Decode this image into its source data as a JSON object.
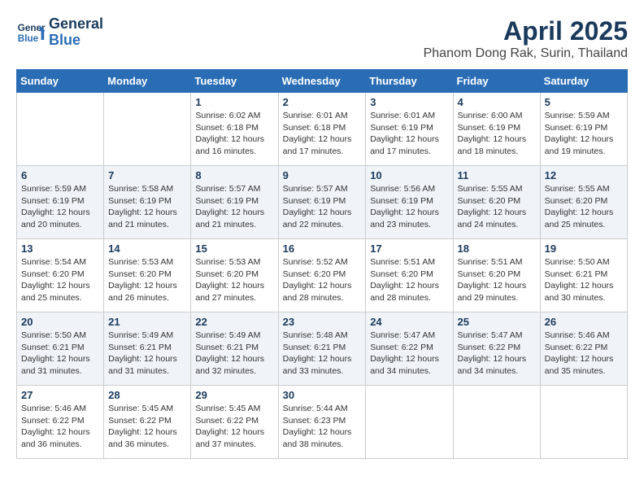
{
  "header": {
    "logo_line1": "General",
    "logo_line2": "Blue",
    "title": "April 2025",
    "subtitle": "Phanom Dong Rak, Surin, Thailand"
  },
  "weekdays": [
    "Sunday",
    "Monday",
    "Tuesday",
    "Wednesday",
    "Thursday",
    "Friday",
    "Saturday"
  ],
  "weeks": [
    [
      {
        "day": "",
        "info": ""
      },
      {
        "day": "",
        "info": ""
      },
      {
        "day": "1",
        "sunrise": "Sunrise: 6:02 AM",
        "sunset": "Sunset: 6:18 PM",
        "daylight": "Daylight: 12 hours and 16 minutes."
      },
      {
        "day": "2",
        "sunrise": "Sunrise: 6:01 AM",
        "sunset": "Sunset: 6:18 PM",
        "daylight": "Daylight: 12 hours and 17 minutes."
      },
      {
        "day": "3",
        "sunrise": "Sunrise: 6:01 AM",
        "sunset": "Sunset: 6:19 PM",
        "daylight": "Daylight: 12 hours and 17 minutes."
      },
      {
        "day": "4",
        "sunrise": "Sunrise: 6:00 AM",
        "sunset": "Sunset: 6:19 PM",
        "daylight": "Daylight: 12 hours and 18 minutes."
      },
      {
        "day": "5",
        "sunrise": "Sunrise: 5:59 AM",
        "sunset": "Sunset: 6:19 PM",
        "daylight": "Daylight: 12 hours and 19 minutes."
      }
    ],
    [
      {
        "day": "6",
        "sunrise": "Sunrise: 5:59 AM",
        "sunset": "Sunset: 6:19 PM",
        "daylight": "Daylight: 12 hours and 20 minutes."
      },
      {
        "day": "7",
        "sunrise": "Sunrise: 5:58 AM",
        "sunset": "Sunset: 6:19 PM",
        "daylight": "Daylight: 12 hours and 21 minutes."
      },
      {
        "day": "8",
        "sunrise": "Sunrise: 5:57 AM",
        "sunset": "Sunset: 6:19 PM",
        "daylight": "Daylight: 12 hours and 21 minutes."
      },
      {
        "day": "9",
        "sunrise": "Sunrise: 5:57 AM",
        "sunset": "Sunset: 6:19 PM",
        "daylight": "Daylight: 12 hours and 22 minutes."
      },
      {
        "day": "10",
        "sunrise": "Sunrise: 5:56 AM",
        "sunset": "Sunset: 6:19 PM",
        "daylight": "Daylight: 12 hours and 23 minutes."
      },
      {
        "day": "11",
        "sunrise": "Sunrise: 5:55 AM",
        "sunset": "Sunset: 6:20 PM",
        "daylight": "Daylight: 12 hours and 24 minutes."
      },
      {
        "day": "12",
        "sunrise": "Sunrise: 5:55 AM",
        "sunset": "Sunset: 6:20 PM",
        "daylight": "Daylight: 12 hours and 25 minutes."
      }
    ],
    [
      {
        "day": "13",
        "sunrise": "Sunrise: 5:54 AM",
        "sunset": "Sunset: 6:20 PM",
        "daylight": "Daylight: 12 hours and 25 minutes."
      },
      {
        "day": "14",
        "sunrise": "Sunrise: 5:53 AM",
        "sunset": "Sunset: 6:20 PM",
        "daylight": "Daylight: 12 hours and 26 minutes."
      },
      {
        "day": "15",
        "sunrise": "Sunrise: 5:53 AM",
        "sunset": "Sunset: 6:20 PM",
        "daylight": "Daylight: 12 hours and 27 minutes."
      },
      {
        "day": "16",
        "sunrise": "Sunrise: 5:52 AM",
        "sunset": "Sunset: 6:20 PM",
        "daylight": "Daylight: 12 hours and 28 minutes."
      },
      {
        "day": "17",
        "sunrise": "Sunrise: 5:51 AM",
        "sunset": "Sunset: 6:20 PM",
        "daylight": "Daylight: 12 hours and 28 minutes."
      },
      {
        "day": "18",
        "sunrise": "Sunrise: 5:51 AM",
        "sunset": "Sunset: 6:20 PM",
        "daylight": "Daylight: 12 hours and 29 minutes."
      },
      {
        "day": "19",
        "sunrise": "Sunrise: 5:50 AM",
        "sunset": "Sunset: 6:21 PM",
        "daylight": "Daylight: 12 hours and 30 minutes."
      }
    ],
    [
      {
        "day": "20",
        "sunrise": "Sunrise: 5:50 AM",
        "sunset": "Sunset: 6:21 PM",
        "daylight": "Daylight: 12 hours and 31 minutes."
      },
      {
        "day": "21",
        "sunrise": "Sunrise: 5:49 AM",
        "sunset": "Sunset: 6:21 PM",
        "daylight": "Daylight: 12 hours and 31 minutes."
      },
      {
        "day": "22",
        "sunrise": "Sunrise: 5:49 AM",
        "sunset": "Sunset: 6:21 PM",
        "daylight": "Daylight: 12 hours and 32 minutes."
      },
      {
        "day": "23",
        "sunrise": "Sunrise: 5:48 AM",
        "sunset": "Sunset: 6:21 PM",
        "daylight": "Daylight: 12 hours and 33 minutes."
      },
      {
        "day": "24",
        "sunrise": "Sunrise: 5:47 AM",
        "sunset": "Sunset: 6:22 PM",
        "daylight": "Daylight: 12 hours and 34 minutes."
      },
      {
        "day": "25",
        "sunrise": "Sunrise: 5:47 AM",
        "sunset": "Sunset: 6:22 PM",
        "daylight": "Daylight: 12 hours and 34 minutes."
      },
      {
        "day": "26",
        "sunrise": "Sunrise: 5:46 AM",
        "sunset": "Sunset: 6:22 PM",
        "daylight": "Daylight: 12 hours and 35 minutes."
      }
    ],
    [
      {
        "day": "27",
        "sunrise": "Sunrise: 5:46 AM",
        "sunset": "Sunset: 6:22 PM",
        "daylight": "Daylight: 12 hours and 36 minutes."
      },
      {
        "day": "28",
        "sunrise": "Sunrise: 5:45 AM",
        "sunset": "Sunset: 6:22 PM",
        "daylight": "Daylight: 12 hours and 36 minutes."
      },
      {
        "day": "29",
        "sunrise": "Sunrise: 5:45 AM",
        "sunset": "Sunset: 6:22 PM",
        "daylight": "Daylight: 12 hours and 37 minutes."
      },
      {
        "day": "30",
        "sunrise": "Sunrise: 5:44 AM",
        "sunset": "Sunset: 6:23 PM",
        "daylight": "Daylight: 12 hours and 38 minutes."
      },
      {
        "day": "",
        "info": ""
      },
      {
        "day": "",
        "info": ""
      },
      {
        "day": "",
        "info": ""
      }
    ]
  ]
}
